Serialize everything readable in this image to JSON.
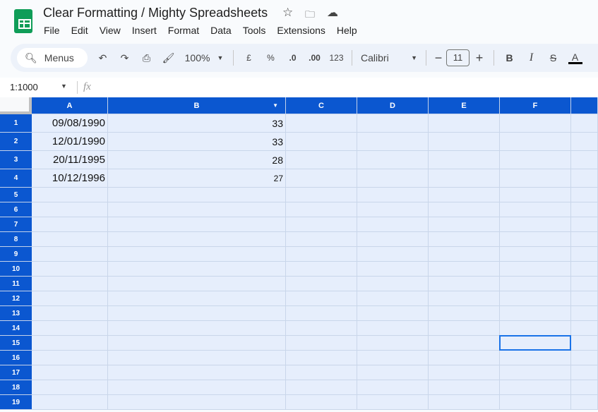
{
  "app": {
    "title": "Clear Formatting / Mighty Spreadsheets",
    "menus": [
      "File",
      "Edit",
      "View",
      "Insert",
      "Format",
      "Data",
      "Tools",
      "Extensions",
      "Help"
    ]
  },
  "toolbar": {
    "search_label": "Menus",
    "zoom": "100%",
    "currency": "£",
    "percent": "%",
    "dec_decrease": ".0",
    "dec_increase": ".00",
    "number_format": "123",
    "font": "Calibri",
    "font_size": "11",
    "text_color": "#000000"
  },
  "formula_bar": {
    "name_box": "1:1000",
    "fx": "fx",
    "value": ""
  },
  "sheet": {
    "columns": [
      "A",
      "B",
      "C",
      "D",
      "E",
      "F"
    ],
    "rows": [
      "1",
      "2",
      "3",
      "4",
      "5",
      "6",
      "7",
      "8",
      "9",
      "10",
      "11",
      "12",
      "13",
      "14",
      "15",
      "16",
      "17",
      "18",
      "19"
    ],
    "data": [
      [
        "09/08/1990",
        "33"
      ],
      [
        "12/01/1990",
        "33"
      ],
      [
        "20/11/1995",
        "28"
      ],
      [
        "10/12/1996",
        "27"
      ]
    ],
    "selected_cell": "F15",
    "header_color": "#0b57d0",
    "selection_fill": "#e6eefc"
  }
}
